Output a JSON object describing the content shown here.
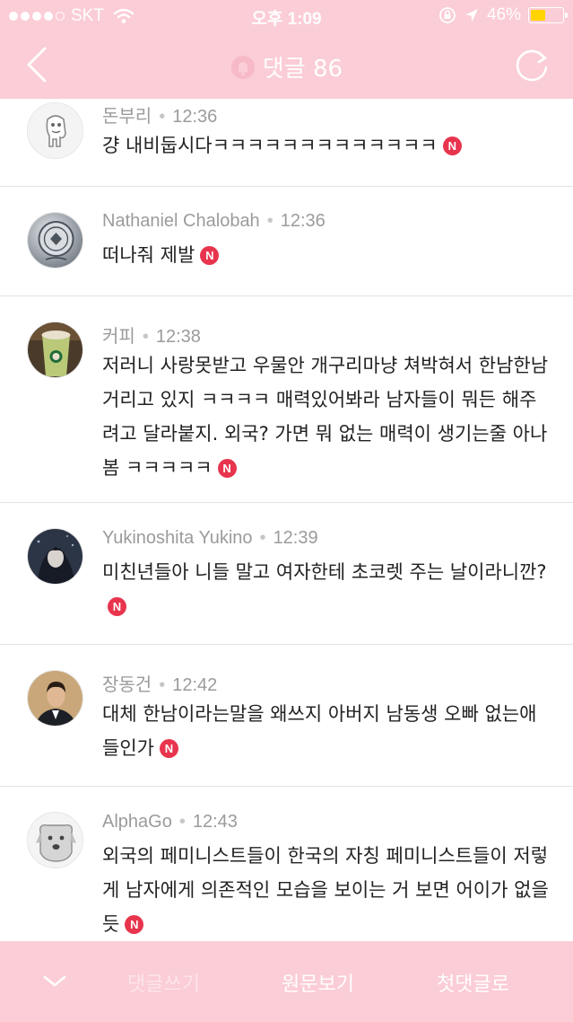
{
  "status_bar": {
    "carrier": "SKT",
    "time": "오후 1:09",
    "battery": "46%",
    "battery_level": 0.46,
    "signal_bars_filled": 4,
    "signal_bars_total": 5
  },
  "nav": {
    "title": "댓글 86",
    "back_icon": "chevron-left-icon",
    "bell_icon": "bell-icon",
    "refresh_icon": "refresh-icon"
  },
  "comments": [
    {
      "author": "돈부리",
      "time": "12:36",
      "text": "걍 내비둡시다ㅋㅋㅋㅋㅋㅋㅋㅋㅋㅋㅋㅋㅋ",
      "badge": "N",
      "avatar": "cartoon-character"
    },
    {
      "author": "Nathaniel Chalobah",
      "time": "12:36",
      "text": "떠나줘 제발",
      "badge": "N",
      "avatar": "club-crest"
    },
    {
      "author": "커피",
      "time": "12:38",
      "text": "저러니 사랑못받고 우물안 개구리마냥 쳐박혀서 한남한남 거리고 있지 ㅋㅋㅋㅋ 매력있어봐라 남자들이 뭐든 해주려고 달라붙지. 외국? 가면 뭐 없는 매력이 생기는줄 아나봄 ㅋㅋㅋㅋㅋ",
      "badge": "N",
      "avatar": "coffee-drink"
    },
    {
      "author": "Yukinoshita Yukino",
      "time": "12:39",
      "text": "미친년들아 니들 말고 여자한테 초코렛 주는 날이라니깐?",
      "badge": "N",
      "avatar": "anime-girl"
    },
    {
      "author": "장동건",
      "time": "12:42",
      "text": "대체 한남이라는말을 왜쓰지 아버지 남동생 오빠 없는애들인가",
      "badge": "N",
      "avatar": "man-portrait"
    },
    {
      "author": "AlphaGo",
      "time": "12:43",
      "text": "외국의 페미니스트들이 한국의 자칭 페미니스트들이 저렇게 남자에게 의존적인 모습을 보이는 거 보면 어이가 없을듯",
      "badge": "N",
      "avatar": "cartoon-dog"
    }
  ],
  "toolbar": {
    "collapse_icon": "chevron-down-icon",
    "write_comment": "댓글쓰기",
    "view_original": "원문보기",
    "first_comment": "첫댓글로"
  },
  "colors": {
    "header_bg": "#fbcdd6",
    "badge": "#e8344d",
    "meta_text": "#9b9b9b"
  }
}
